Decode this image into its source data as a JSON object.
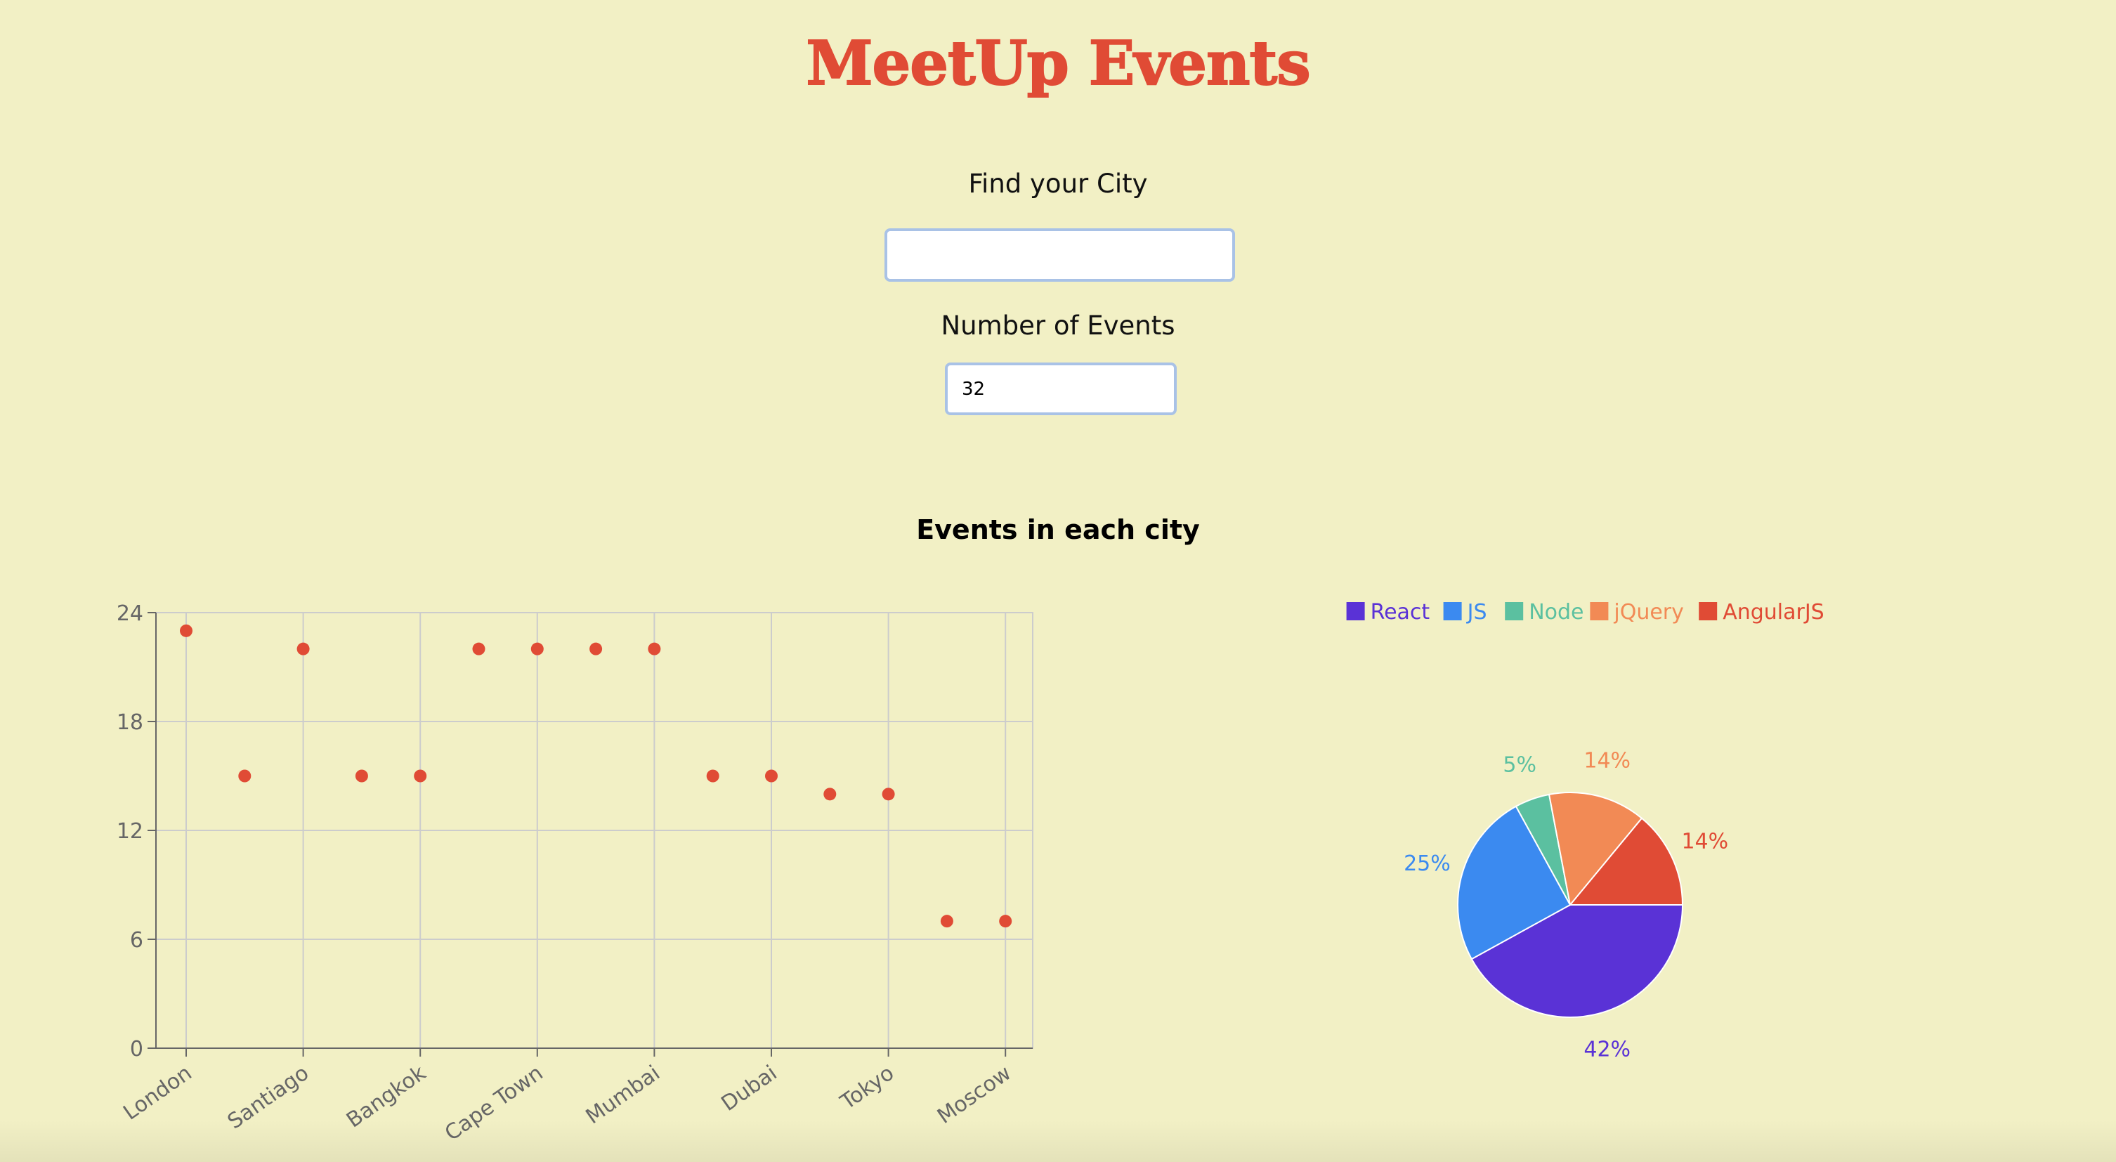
{
  "app": {
    "title": "MeetUp Events"
  },
  "city_search": {
    "label": "Find your City",
    "value": "",
    "placeholder": ""
  },
  "number_of_events": {
    "label": "Number of Events",
    "value": "32"
  },
  "charts_section": {
    "heading": "Events in each city"
  },
  "colors": {
    "background": "#f2f0c5",
    "title": "#e04b35",
    "scatter_point": "#e04b35",
    "React": "#5a32d6",
    "JS": "#3b8af0",
    "Node": "#5bc0a0",
    "jQuery": "#f28a55",
    "AngularJS": "#e04b35"
  },
  "chart_data": [
    {
      "type": "scatter",
      "title": "",
      "xlabel": "",
      "ylabel": "",
      "x_tick_labels": [
        "London",
        "Santiago",
        "Bangkok",
        "Cape Town",
        "Mumbai",
        "Dubai",
        "Tokyo",
        "Moscow"
      ],
      "y_ticks": [
        0,
        6,
        12,
        18,
        24
      ],
      "ylim": [
        0,
        24
      ],
      "grid": true,
      "points": [
        23,
        15,
        22,
        15,
        15,
        22,
        22,
        22,
        22,
        15,
        15,
        14,
        14,
        7,
        7
      ]
    },
    {
      "type": "pie",
      "title": "",
      "legend_position": "top",
      "slices": [
        {
          "label": "React",
          "value": 42,
          "display": "42%"
        },
        {
          "label": "JS",
          "value": 25,
          "display": "25%"
        },
        {
          "label": "Node",
          "value": 5,
          "display": "5%"
        },
        {
          "label": "jQuery",
          "value": 14,
          "display": "14%"
        },
        {
          "label": "AngularJS",
          "value": 14,
          "display": "14%"
        }
      ]
    }
  ]
}
